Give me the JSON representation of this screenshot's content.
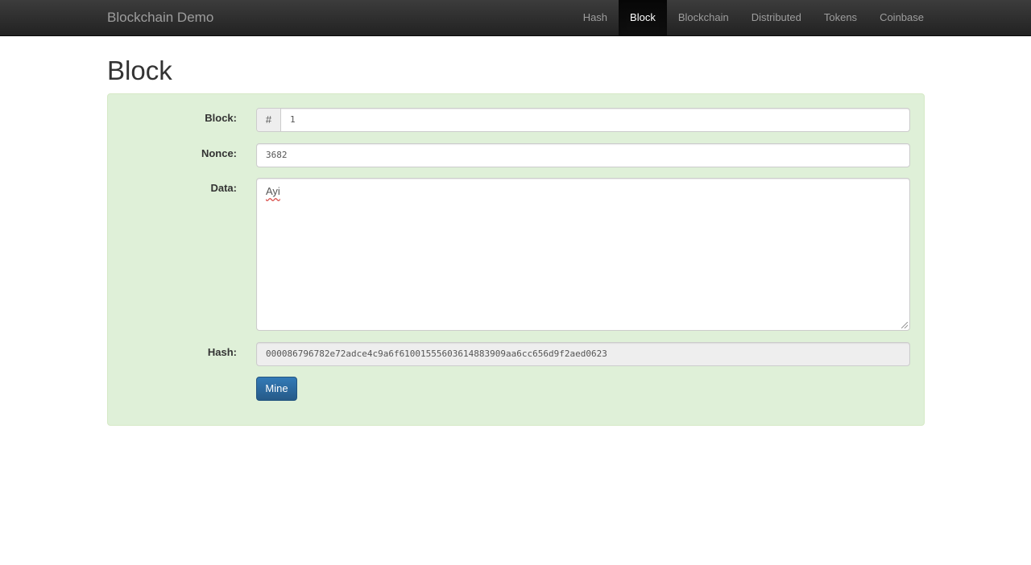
{
  "navbar": {
    "brand": "Blockchain Demo",
    "items": [
      {
        "label": "Hash",
        "active": false
      },
      {
        "label": "Block",
        "active": true
      },
      {
        "label": "Blockchain",
        "active": false
      },
      {
        "label": "Distributed",
        "active": false
      },
      {
        "label": "Tokens",
        "active": false
      },
      {
        "label": "Coinbase",
        "active": false
      }
    ]
  },
  "page": {
    "title": "Block"
  },
  "form": {
    "block_label": "Block:",
    "block_addon": "#",
    "block_value": "1",
    "nonce_label": "Nonce:",
    "nonce_value": "3682",
    "data_label": "Data:",
    "data_value": "Ayi",
    "hash_label": "Hash:",
    "hash_value": "000086796782e72adce4c9a6f61001555603614883909aa6cc656d9f2aed0623",
    "mine_label": "Mine"
  },
  "colors": {
    "navbar_bg": "#222222",
    "well_bg": "#dff0d8",
    "button_primary": "#337ab7"
  }
}
